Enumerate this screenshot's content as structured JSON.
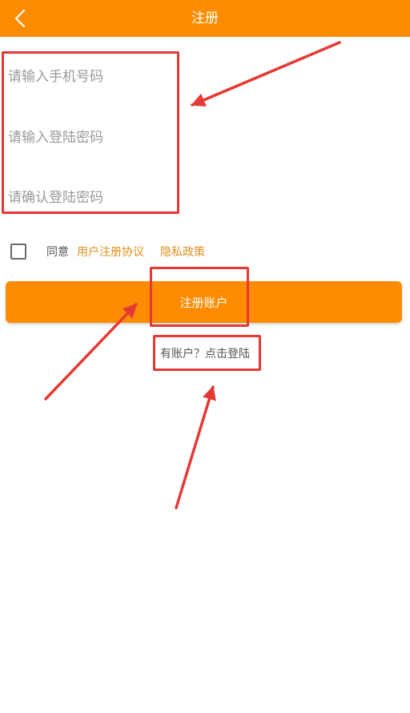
{
  "header": {
    "title": "注册",
    "back_icon": "chevron-left-icon",
    "color": "#FF8C00"
  },
  "form": {
    "phone_placeholder": "请输入手机号码",
    "password_placeholder": "请输入登陆密码",
    "confirm_placeholder": "请确认登陆密码"
  },
  "agreement": {
    "prefix": "同意",
    "terms_link": "用户注册协议",
    "privacy_link": "隐私政策",
    "link_color": "#E0901A"
  },
  "register_button": {
    "label": "注册账户",
    "color": "#FF8C00"
  },
  "login_link": {
    "label": "有账户？点击登陆"
  },
  "annotation_color": "#E53935"
}
